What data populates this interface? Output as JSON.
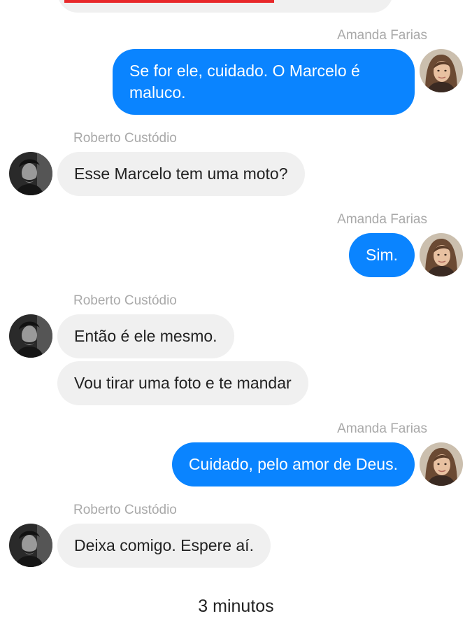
{
  "contacts": {
    "amanda": {
      "name": "Amanda Farias",
      "avatar_icon": "woman-portrait-avatar"
    },
    "roberto": {
      "name": "Roberto Custódio",
      "avatar_icon": "man-portrait-avatar"
    }
  },
  "messages": [
    {
      "sender_label": "Amanda Farias",
      "text": "Se for ele, cuidado. O Marcelo é maluco.",
      "direction": "outgoing"
    },
    {
      "sender_label": "Roberto Custódio",
      "text": "Esse Marcelo tem uma moto?",
      "direction": "incoming"
    },
    {
      "sender_label": "Amanda Farias",
      "text": "Sim.",
      "direction": "outgoing"
    },
    {
      "sender_label": "Roberto Custódio",
      "text": "Então é ele mesmo.",
      "direction": "incoming"
    },
    {
      "sender_label": "",
      "text": "Vou tirar uma foto e te mandar",
      "direction": "incoming"
    },
    {
      "sender_label": "Amanda Farias",
      "text": "Cuidado, pelo amor de Deus.",
      "direction": "outgoing"
    },
    {
      "sender_label": "Roberto Custódio",
      "text": "Deixa comigo. Espere aí.",
      "direction": "incoming"
    }
  ],
  "footer": {
    "timestamp": "3 minutos"
  },
  "colors": {
    "outgoing_bubble": "#0a84ff",
    "incoming_bubble": "#f0f0f0",
    "sender_name": "#a9a9a9",
    "accent_red": "#e8282a"
  }
}
